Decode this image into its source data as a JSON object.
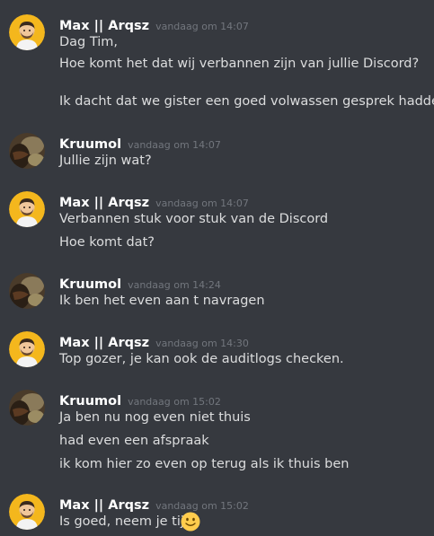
{
  "messages": [
    {
      "author": "Max || Arqsz",
      "avatar": "max-avatar-icon",
      "timestamp": "vandaag om 14:07",
      "lines": [
        "Dag Tim,",
        "Hoe komt het dat wij verbannen zijn van jullie Discord?",
        "",
        "Ik dacht dat we gister een goed volwassen gesprek hadden?"
      ]
    },
    {
      "author": "Kruumol",
      "avatar": "kruumol-avatar-icon",
      "timestamp": "vandaag om 14:07",
      "lines": [
        "Jullie zijn wat?"
      ]
    },
    {
      "author": "Max || Arqsz",
      "avatar": "max-avatar-icon",
      "timestamp": "vandaag om 14:07",
      "lines": [
        "Verbannen stuk voor stuk van de Discord",
        "Hoe komt dat?"
      ]
    },
    {
      "author": "Kruumol",
      "avatar": "kruumol-avatar-icon",
      "timestamp": "vandaag om 14:24",
      "lines": [
        "Ik ben het even aan t navragen"
      ]
    },
    {
      "author": "Max || Arqsz",
      "avatar": "max-avatar-icon",
      "timestamp": "vandaag om 14:30",
      "lines": [
        "Top gozer, je kan ook de auditlogs checken."
      ]
    },
    {
      "author": "Kruumol",
      "avatar": "kruumol-avatar-icon",
      "timestamp": "vandaag om 15:02",
      "lines": [
        "Ja ben nu nog even niet thuis",
        "had even een afspraak",
        "ik kom hier zo even op terug als ik thuis ben"
      ]
    },
    {
      "author": "Max || Arqsz",
      "avatar": "max-avatar-icon",
      "timestamp": "vandaag om 15:02",
      "lines": [
        "Is goed, neem je tijd"
      ],
      "emoji": "slightly-smiling-face-icon"
    }
  ],
  "colors": {
    "background": "#36393f",
    "author": "#ffffff",
    "message_text": "#dcddde",
    "timestamp": "#72767d",
    "max_avatar_bg": "#f4b71d",
    "kruumol_avatar_bg": "#4a3b2a"
  }
}
